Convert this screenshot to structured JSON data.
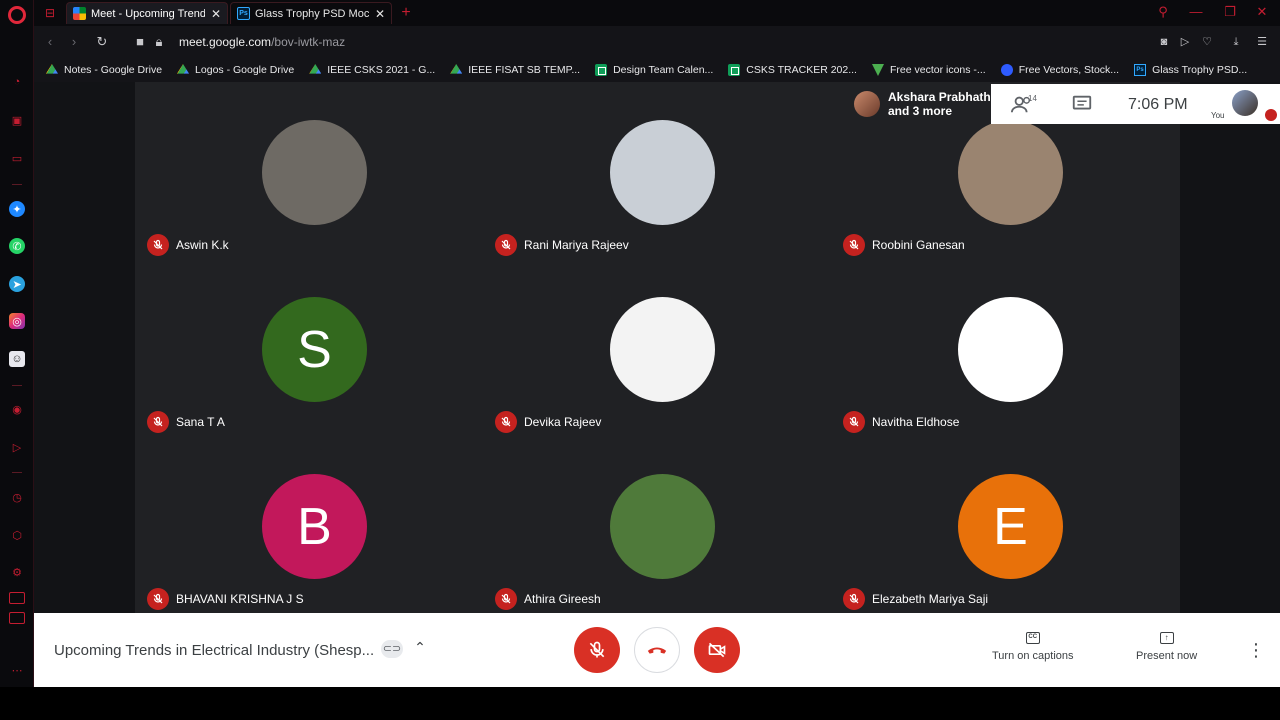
{
  "browser": {
    "tabs": [
      {
        "title": "Meet - Upcoming Trends in",
        "favicon": "meet-icon",
        "active": true
      },
      {
        "title": "Glass Trophy PSD Mockup",
        "favicon": "photoshop-icon",
        "active": false
      }
    ],
    "new_tab_symbol": "+",
    "url_domain": "meet.google.com",
    "url_path": "/bov-iwtk-maz",
    "bookmarks": [
      {
        "label": "Notes - Google Drive",
        "icon": "drive-icon"
      },
      {
        "label": "Logos - Google Drive",
        "icon": "drive-icon"
      },
      {
        "label": "IEEE CSKS 2021 - G...",
        "icon": "drive-icon"
      },
      {
        "label": "IEEE FISAT SB TEMP...",
        "icon": "drive-icon"
      },
      {
        "label": "Design Team Calen...",
        "icon": "sheets-icon"
      },
      {
        "label": "CSKS TRACKER 202...",
        "icon": "sheets-icon"
      },
      {
        "label": "Free vector icons -...",
        "icon": "vector-icon"
      },
      {
        "label": "Free Vectors, Stock...",
        "icon": "freepik-icon"
      },
      {
        "label": "Glass Trophy PSD...",
        "icon": "photoshop-icon"
      }
    ]
  },
  "meet": {
    "active_speaker": {
      "line1": "Akshara Prabhath",
      "line2": "and 3 more"
    },
    "participant_count": "14",
    "time": "7:06 PM",
    "self_label": "You",
    "participants": [
      {
        "name": "Aswin K.k",
        "initial": "",
        "color": "#6e6a64"
      },
      {
        "name": "Rani Mariya Rajeev",
        "initial": "",
        "color": "#c9cfd6"
      },
      {
        "name": "Roobini Ganesan",
        "initial": "",
        "color": "#9a8470"
      },
      {
        "name": "Sana T A",
        "initial": "S",
        "color": "#33691e"
      },
      {
        "name": "Devika Rajeev",
        "initial": "",
        "color": "#f3f3f3"
      },
      {
        "name": "Navitha Eldhose",
        "initial": "",
        "color": "#ffffff"
      },
      {
        "name": "BHAVANI KRISHNA J S",
        "initial": "B",
        "color": "#c2185b"
      },
      {
        "name": "Athira Gireesh",
        "initial": "",
        "color": "#4f7a3a"
      },
      {
        "name": "Elezabeth Mariya Saji",
        "initial": "E",
        "color": "#e8710a"
      }
    ],
    "meeting_title": "Upcoming Trends in Electrical Industry (Shesp...",
    "captions_label": "Turn on captions",
    "captions_icon_text": "CC",
    "present_label": "Present now"
  }
}
